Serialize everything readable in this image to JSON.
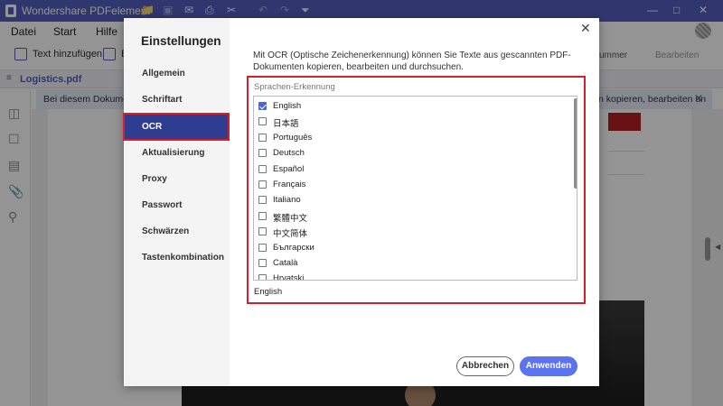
{
  "app": {
    "title": "Wondershare PDFelement"
  },
  "menu": [
    "Datei",
    "Start",
    "Hilfe"
  ],
  "toolbar": {
    "text_add": "Text hinzufügen",
    "bild_prefix": "B",
    "nummer": "ummer",
    "bearbeiten": "Bearbeiten"
  },
  "file": {
    "name": "Logistics.pdf"
  },
  "banner": {
    "left_text": "Bei diesem Dokument h",
    "right_text": "n kopieren, bearbeiten un"
  },
  "dialog": {
    "title": "Einstellungen",
    "nav": [
      "Allgemein",
      "Schriftart",
      "OCR",
      "Aktualisierung",
      "Proxy",
      "Passwort",
      "Schwärzen",
      "Tastenkombination"
    ],
    "active_nav": "OCR",
    "description": "Mit OCR (Optische Zeichenerkennung) können Sie Texte aus gescannten PDF-Dokumenten kopieren, bearbeiten und durchsuchen.",
    "lang_label": "Sprachen-Erkennung",
    "languages": [
      {
        "label": "English",
        "checked": true
      },
      {
        "label": "日本語",
        "checked": false
      },
      {
        "label": "Português",
        "checked": false
      },
      {
        "label": "Deutsch",
        "checked": false
      },
      {
        "label": "Español",
        "checked": false
      },
      {
        "label": "Français",
        "checked": false
      },
      {
        "label": "Italiano",
        "checked": false
      },
      {
        "label": "繁體中文",
        "checked": false
      },
      {
        "label": "中文简体",
        "checked": false
      },
      {
        "label": "Български",
        "checked": false
      },
      {
        "label": "Català",
        "checked": false
      },
      {
        "label": "Hrvatski",
        "checked": false
      }
    ],
    "selected_summary": "English",
    "cancel": "Abbrechen",
    "apply": "Anwenden",
    "accent_color": "#2f3d91",
    "highlight_color": "#d81e2c"
  }
}
